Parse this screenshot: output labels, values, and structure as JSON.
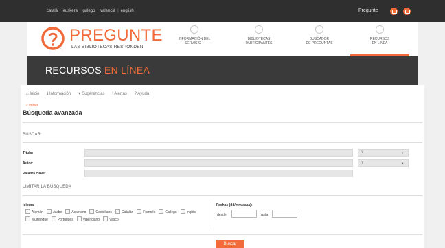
{
  "topbar": {
    "languages": [
      "català",
      "euskera",
      "galego",
      "valencià",
      "english"
    ],
    "pregunte_link": "Pregunte",
    "icons": [
      "mail-icon",
      "chat-icon"
    ],
    "accent": "#f26b3a"
  },
  "header": {
    "logo_title": "PREGUNTE",
    "logo_subtitle": "LAS BIBLIOTECAS RESPONDEN",
    "nav": [
      {
        "label": "INFORMACIÓN DEL\nSERVICIO +",
        "icon": "info-icon"
      },
      {
        "label": "BIBLIOTECAS\nPARTICIPANTES",
        "icon": "library-icon"
      },
      {
        "label": "BUSCADOR\nDE PREGUNTAS",
        "icon": "search-icon"
      },
      {
        "label": "RECURSOS\nEN LÍNEA",
        "icon": "globe-icon",
        "active": true
      }
    ]
  },
  "banner": {
    "title_part1": "RECURSOS ",
    "title_part2": "EN LÍNEA"
  },
  "breadcrumbs": [
    "Inicio",
    "Información",
    "Sugerencias",
    "Alertas",
    "Ayuda"
  ],
  "page": {
    "back": "« volver",
    "title": "Búsqueda avanzada"
  },
  "buscar": {
    "heading": "BUSCAR",
    "fields": [
      {
        "label": "Título:",
        "value": "",
        "select": "Y"
      },
      {
        "label": "Autor:",
        "value": "",
        "select": "Y"
      },
      {
        "label": "Palabra clave:",
        "value": ""
      }
    ]
  },
  "limitar": {
    "heading": "LIMITAR LA BÚSQUEDA",
    "idioma_label": "Idioma",
    "idiomas": [
      "Alemán",
      "Árabe",
      "Asturiano",
      "Castellano",
      "Catalán",
      "Francés",
      "Gallego",
      "Inglés",
      "Multilingüe",
      "Portugués",
      "Valenciano",
      "Vasco"
    ],
    "fechas_label": "Fechas (dd/mm/aaaa):",
    "desde": "desde",
    "hasta": "hasta",
    "desde_value": "",
    "hasta_value": ""
  },
  "actions": {
    "search": "Buscar"
  }
}
